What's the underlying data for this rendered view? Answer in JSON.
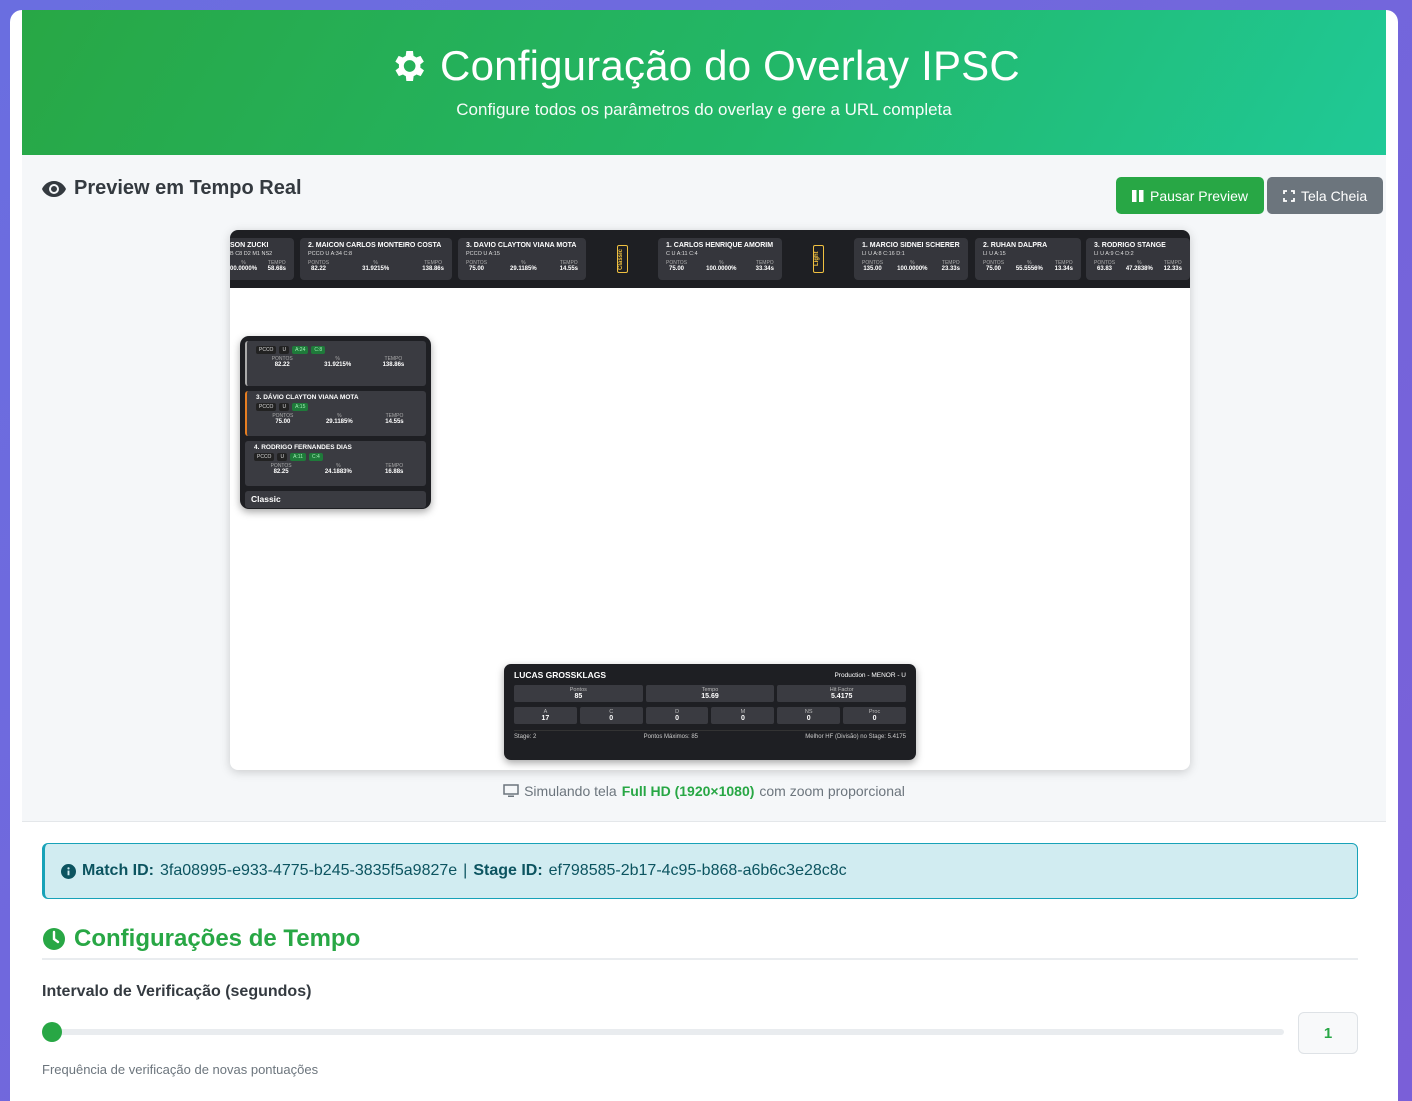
{
  "header": {
    "title": "Configuração do Overlay IPSC",
    "subtitle": "Configure todos os parâmetros do overlay e gere a URL completa"
  },
  "preview": {
    "title": "Preview em Tempo Real",
    "pause_label": "Pausar Preview",
    "fullscreen_label": "Tela Cheia",
    "top_cards": [
      {
        "name": "SON ZUCKI",
        "badges": "B  C8  D2  M1  NS2",
        "pts": "",
        "pct": "00.0000%",
        "time": "58.68s"
      },
      {
        "name": "2. MAICON CARLOS MONTEIRO COSTA",
        "badges": "PCCO  U  A:34  C:8",
        "pts": "82.22",
        "pct": "31.9215%",
        "time": "138.86s"
      },
      {
        "name": "3. DÁVIO CLAYTON VIANA MOTA",
        "badges": "PCCO  U  A:15",
        "pts": "75.00",
        "pct": "29.1185%",
        "time": "14.55s"
      },
      {
        "name": "1. CARLOS HENRIQUE AMORIM",
        "badges": "C  U  A:11  C:4",
        "pts": "75.00",
        "pct": "100.0000%",
        "time": "33.34s"
      },
      {
        "name": "1. MARCIO SIDNEI SCHERER",
        "badges": "LI  U  A:8  C:16  D:1",
        "pts": "135.00",
        "pct": "100.0000%",
        "time": "23.33s"
      },
      {
        "name": "2. RUHAN DALPRÁ",
        "badges": "LI  U  A:15",
        "pts": "75.00",
        "pct": "55.5556%",
        "time": "13.34s"
      },
      {
        "name": "3. RODRIGO STANGE",
        "badges": "LI  U  A:9  C:4  D:2",
        "pts": "63.83",
        "pct": "47.2838%",
        "time": "12.33s"
      }
    ],
    "tag_classic": "Classic",
    "tag_light": "Light",
    "stat_labels": {
      "pontos": "PONTOS",
      "pct": "%",
      "tempo": "TEMPO"
    },
    "left_rows": [
      {
        "name": "",
        "chips": [
          "PCCO",
          "U"
        ],
        "green": [
          "A:24",
          "C:8"
        ],
        "pts": "82.22",
        "pct": "31.9215%",
        "time": "138.86s"
      },
      {
        "name": "3. DÁVIO CLAYTON VIANA MOTA",
        "chips": [
          "PCCO",
          "U"
        ],
        "green": [
          "A:15"
        ],
        "pts": "75.00",
        "pct": "29.1185%",
        "time": "14.55s"
      },
      {
        "name": "4. RODRIGO FERNANDES DIAS",
        "chips": [
          "PCCO",
          "U"
        ],
        "green": [
          "A:11",
          "C:4"
        ],
        "pts": "82.25",
        "pct": "24.1883%",
        "time": "16.88s"
      }
    ],
    "left_footer": "Classic",
    "shooter": {
      "name": "LUCAS GROSSKLAGS",
      "division": "Production - MENOR - U",
      "pontos_label": "Pontos",
      "pontos": "85",
      "tempo_label": "Tempo",
      "tempo": "15.69",
      "hf_label": "Hit Factor",
      "hf": "5.4175",
      "hits": [
        {
          "label": "A",
          "value": "17"
        },
        {
          "label": "C",
          "value": "0"
        },
        {
          "label": "D",
          "value": "0"
        },
        {
          "label": "M",
          "value": "0"
        },
        {
          "label": "NS",
          "value": "0"
        },
        {
          "label": "Proc",
          "value": "0"
        }
      ],
      "stage": "Stage: 2",
      "max_points": "Pontos Máximos: 85",
      "best_hf": "Melhor HF (Divisão) no Stage: 5.4175"
    },
    "sim_prefix": "Simulando tela",
    "sim_bold": "Full HD (1920×1080)",
    "sim_suffix": "com zoom proporcional"
  },
  "ids": {
    "match_label": "Match ID:",
    "match_value": "3fa08995-e933-4775-b245-3835f5a9827e",
    "sep": "|",
    "stage_label": "Stage ID:",
    "stage_value": "ef798585-2b17-4c95-b868-a6b6c3e28c8c"
  },
  "time_config": {
    "section_title": "Configurações de Tempo",
    "interval_label": "Intervalo de Verificação (segundos)",
    "interval_value": "1",
    "help_text": "Frequência de verificação de novas pontuações"
  },
  "colors": {
    "primary": "#28a745",
    "secondary": "#6c757d",
    "info_bg": "#d1ecf1",
    "overlay_dark": "#1e1f23"
  }
}
